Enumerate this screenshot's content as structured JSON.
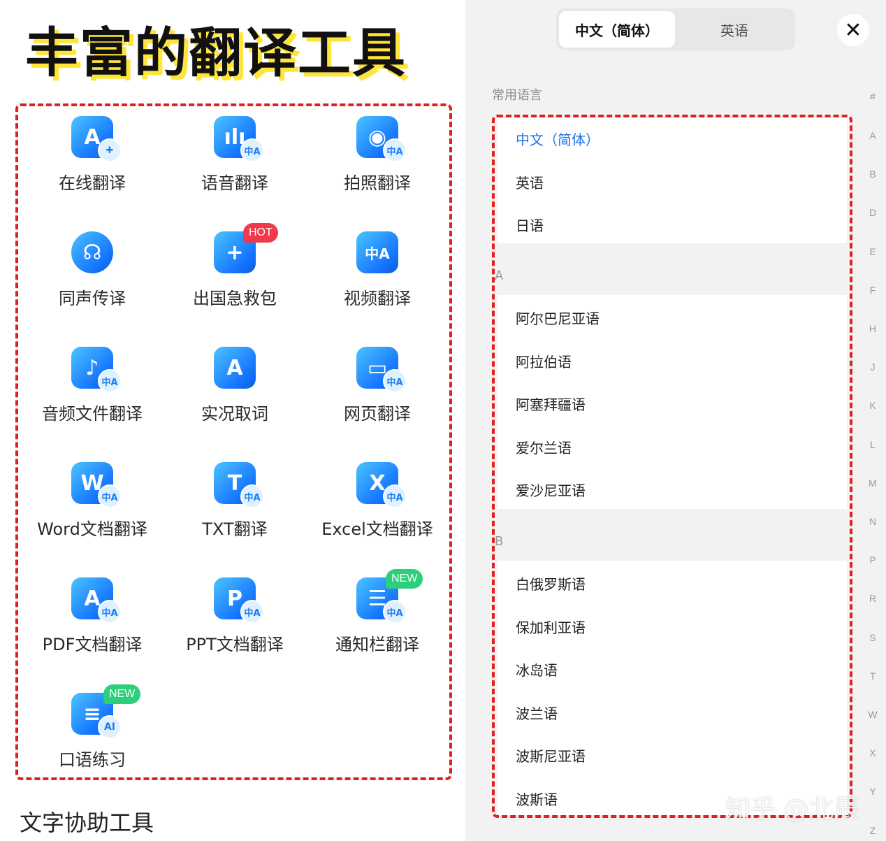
{
  "headline": "丰富的翻译工具",
  "tools": [
    {
      "label": "在线翻译",
      "glyph": "A",
      "sub": "✚",
      "badge": ""
    },
    {
      "label": "语音翻译",
      "glyph": "ılı",
      "sub": "中A",
      "badge": ""
    },
    {
      "label": "拍照翻译",
      "glyph": "◉",
      "sub": "中A",
      "badge": ""
    },
    {
      "label": "同声传译",
      "glyph": "☊",
      "sub": "",
      "badge": ""
    },
    {
      "label": "出国急救包",
      "glyph": "+",
      "sub": "",
      "badge": "HOT"
    },
    {
      "label": "视频翻译",
      "glyph": "中A",
      "sub": "",
      "badge": ""
    },
    {
      "label": "音频文件翻译",
      "glyph": "♪",
      "sub": "中A",
      "badge": ""
    },
    {
      "label": "实况取词",
      "glyph": "A",
      "sub": "",
      "badge": ""
    },
    {
      "label": "网页翻译",
      "glyph": "▭",
      "sub": "中A",
      "badge": ""
    },
    {
      "label": "Word文档翻译",
      "glyph": "W",
      "sub": "中A",
      "badge": ""
    },
    {
      "label": "TXT翻译",
      "glyph": "T",
      "sub": "中A",
      "badge": ""
    },
    {
      "label": "Excel文档翻译",
      "glyph": "X",
      "sub": "中A",
      "badge": ""
    },
    {
      "label": "PDF文档翻译",
      "glyph": "A",
      "sub": "中A",
      "badge": ""
    },
    {
      "label": "PPT文档翻译",
      "glyph": "P",
      "sub": "中A",
      "badge": ""
    },
    {
      "label": "通知栏翻译",
      "glyph": "☰",
      "sub": "中A",
      "badge": "NEW"
    },
    {
      "label": "口语练习",
      "glyph": "≡",
      "sub": "AI",
      "badge": "NEW"
    }
  ],
  "footer_title": "文字协助工具",
  "lang_tabs": {
    "source": "中文（简体）",
    "target": "英语"
  },
  "close_glyph": "✕",
  "section_label": "常用语言",
  "common_languages": [
    "中文（简体）",
    "英语",
    "日语"
  ],
  "groups": [
    {
      "letter": "A",
      "languages": [
        "阿尔巴尼亚语",
        "阿拉伯语",
        "阿塞拜疆语",
        "爱尔兰语",
        "爱沙尼亚语"
      ]
    },
    {
      "letter": "B",
      "languages": [
        "白俄罗斯语",
        "保加利亚语",
        "冰岛语",
        "波兰语",
        "波斯尼亚语",
        "波斯语"
      ]
    }
  ],
  "index_letters": [
    "#",
    "A",
    "B",
    "D",
    "E",
    "F",
    "H",
    "J",
    "K",
    "L",
    "M",
    "N",
    "P",
    "R",
    "S",
    "T",
    "W",
    "X",
    "Y",
    "Z"
  ],
  "watermark": "知乎 @北辰",
  "colors": {
    "accent": "#1a73e8",
    "dashed_border": "#e0201e",
    "highlight": "#ffe43a",
    "hot": "#f2394b",
    "new": "#2ccf7a"
  }
}
